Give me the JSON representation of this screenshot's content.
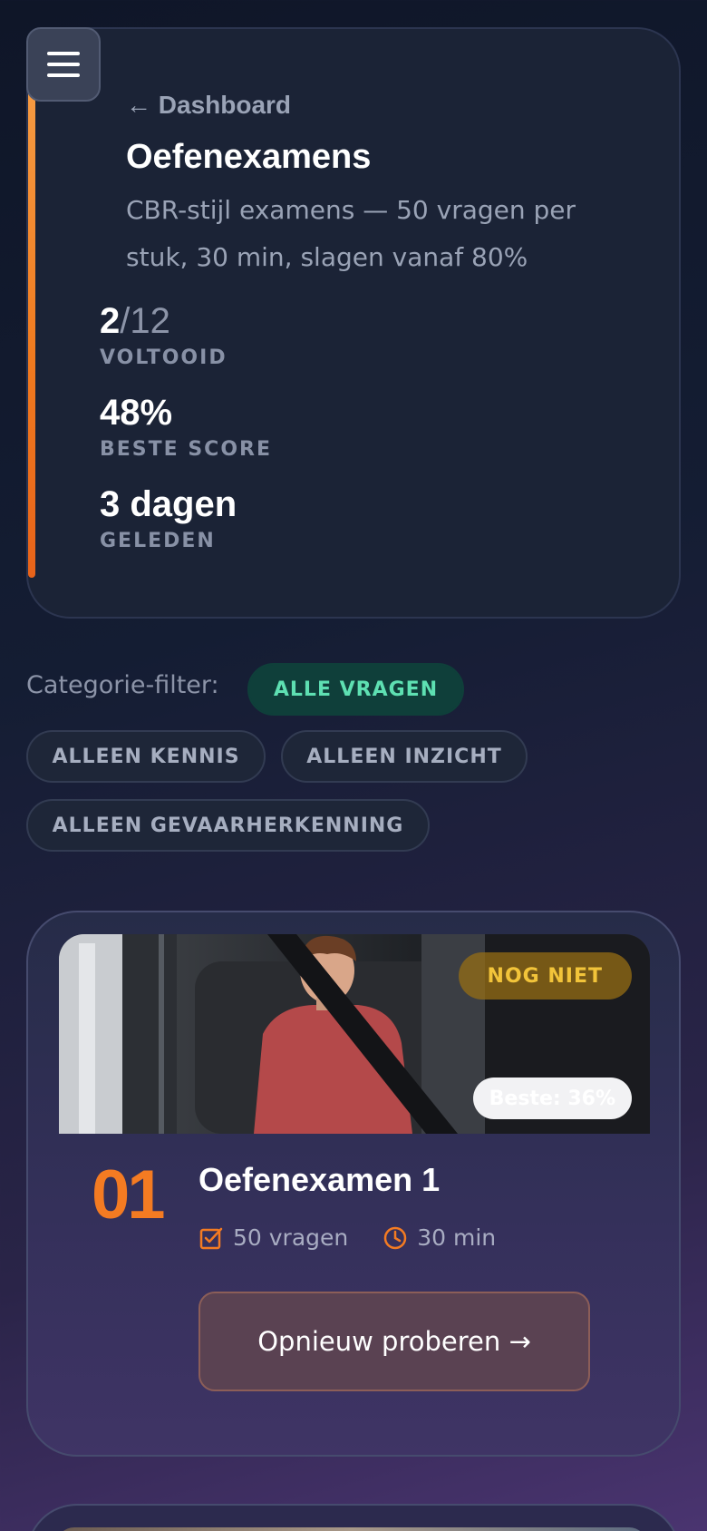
{
  "header": {
    "back_label": "← Dashboard",
    "title": "Oefenexamens",
    "subtitle": "CBR-stijl examens — 50 vragen per stuk, 30 min, slagen vanaf 80%",
    "stats": [
      {
        "value": "2",
        "value_suffix": "/12",
        "label": "VOLTOOID"
      },
      {
        "value": "48%",
        "label": "BESTE SCORE"
      },
      {
        "value": "3 dagen",
        "label": "GELEDEN"
      }
    ]
  },
  "filters": {
    "label": "Categorie-filter:",
    "options": [
      {
        "label": "ALLE VRAGEN",
        "active": true
      },
      {
        "label": "ALLEEN KENNIS",
        "active": false
      },
      {
        "label": "ALLEEN INZICHT",
        "active": false
      },
      {
        "label": "ALLEEN GEVAARHERKENNING",
        "active": false
      }
    ]
  },
  "exams": [
    {
      "number": "01",
      "title": "Oefenexamen 1",
      "status": "NOG NIET",
      "best": "Beste: 36%",
      "questions": "50 vragen",
      "duration": "30 min",
      "action": "Opnieuw proberen →",
      "image": "child-in-car-seatbelt"
    }
  ],
  "colors": {
    "accent": "#f47b22",
    "active_chip_bg": "#0f3f3a",
    "active_chip_text": "#5ee0b2",
    "status_text": "#f2c43a"
  }
}
